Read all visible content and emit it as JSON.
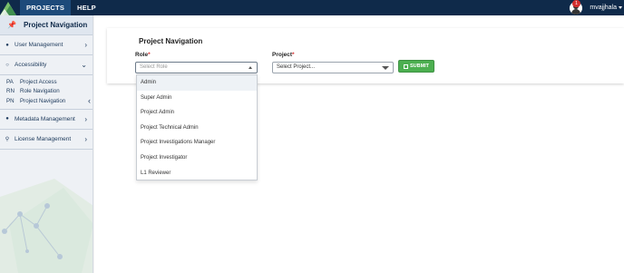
{
  "topbar": {
    "nav": [
      "PROJECTS",
      "HELP"
    ],
    "notification_count": "1",
    "username": "mvajjhala"
  },
  "sidebar": {
    "title": "Project Navigation",
    "items": [
      {
        "label": "User Management"
      },
      {
        "label": "Accessibility"
      },
      {
        "label": "Metadata Management"
      },
      {
        "label": "License Management"
      }
    ],
    "subitems": [
      {
        "abbr": "PA",
        "label": "Project Access"
      },
      {
        "abbr": "RN",
        "label": "Role Navigation"
      },
      {
        "abbr": "PN",
        "label": "Project Navigation"
      }
    ]
  },
  "main": {
    "title": "Project Navigation",
    "role_label": "Role",
    "role_placeholder": "Select Role",
    "project_label": "Project",
    "project_value": "Select Project...",
    "submit_label": "SUBMIT",
    "role_options": [
      "Admin",
      "Super Admin",
      "Project Admin",
      "Project Technical Admin",
      "Project Investigations Manager",
      "Project Investigator",
      "L1 Reviewer"
    ]
  },
  "colors": {
    "topbar": "#0f2a4a",
    "submit": "#4caf50",
    "required": "#d32f2f"
  }
}
